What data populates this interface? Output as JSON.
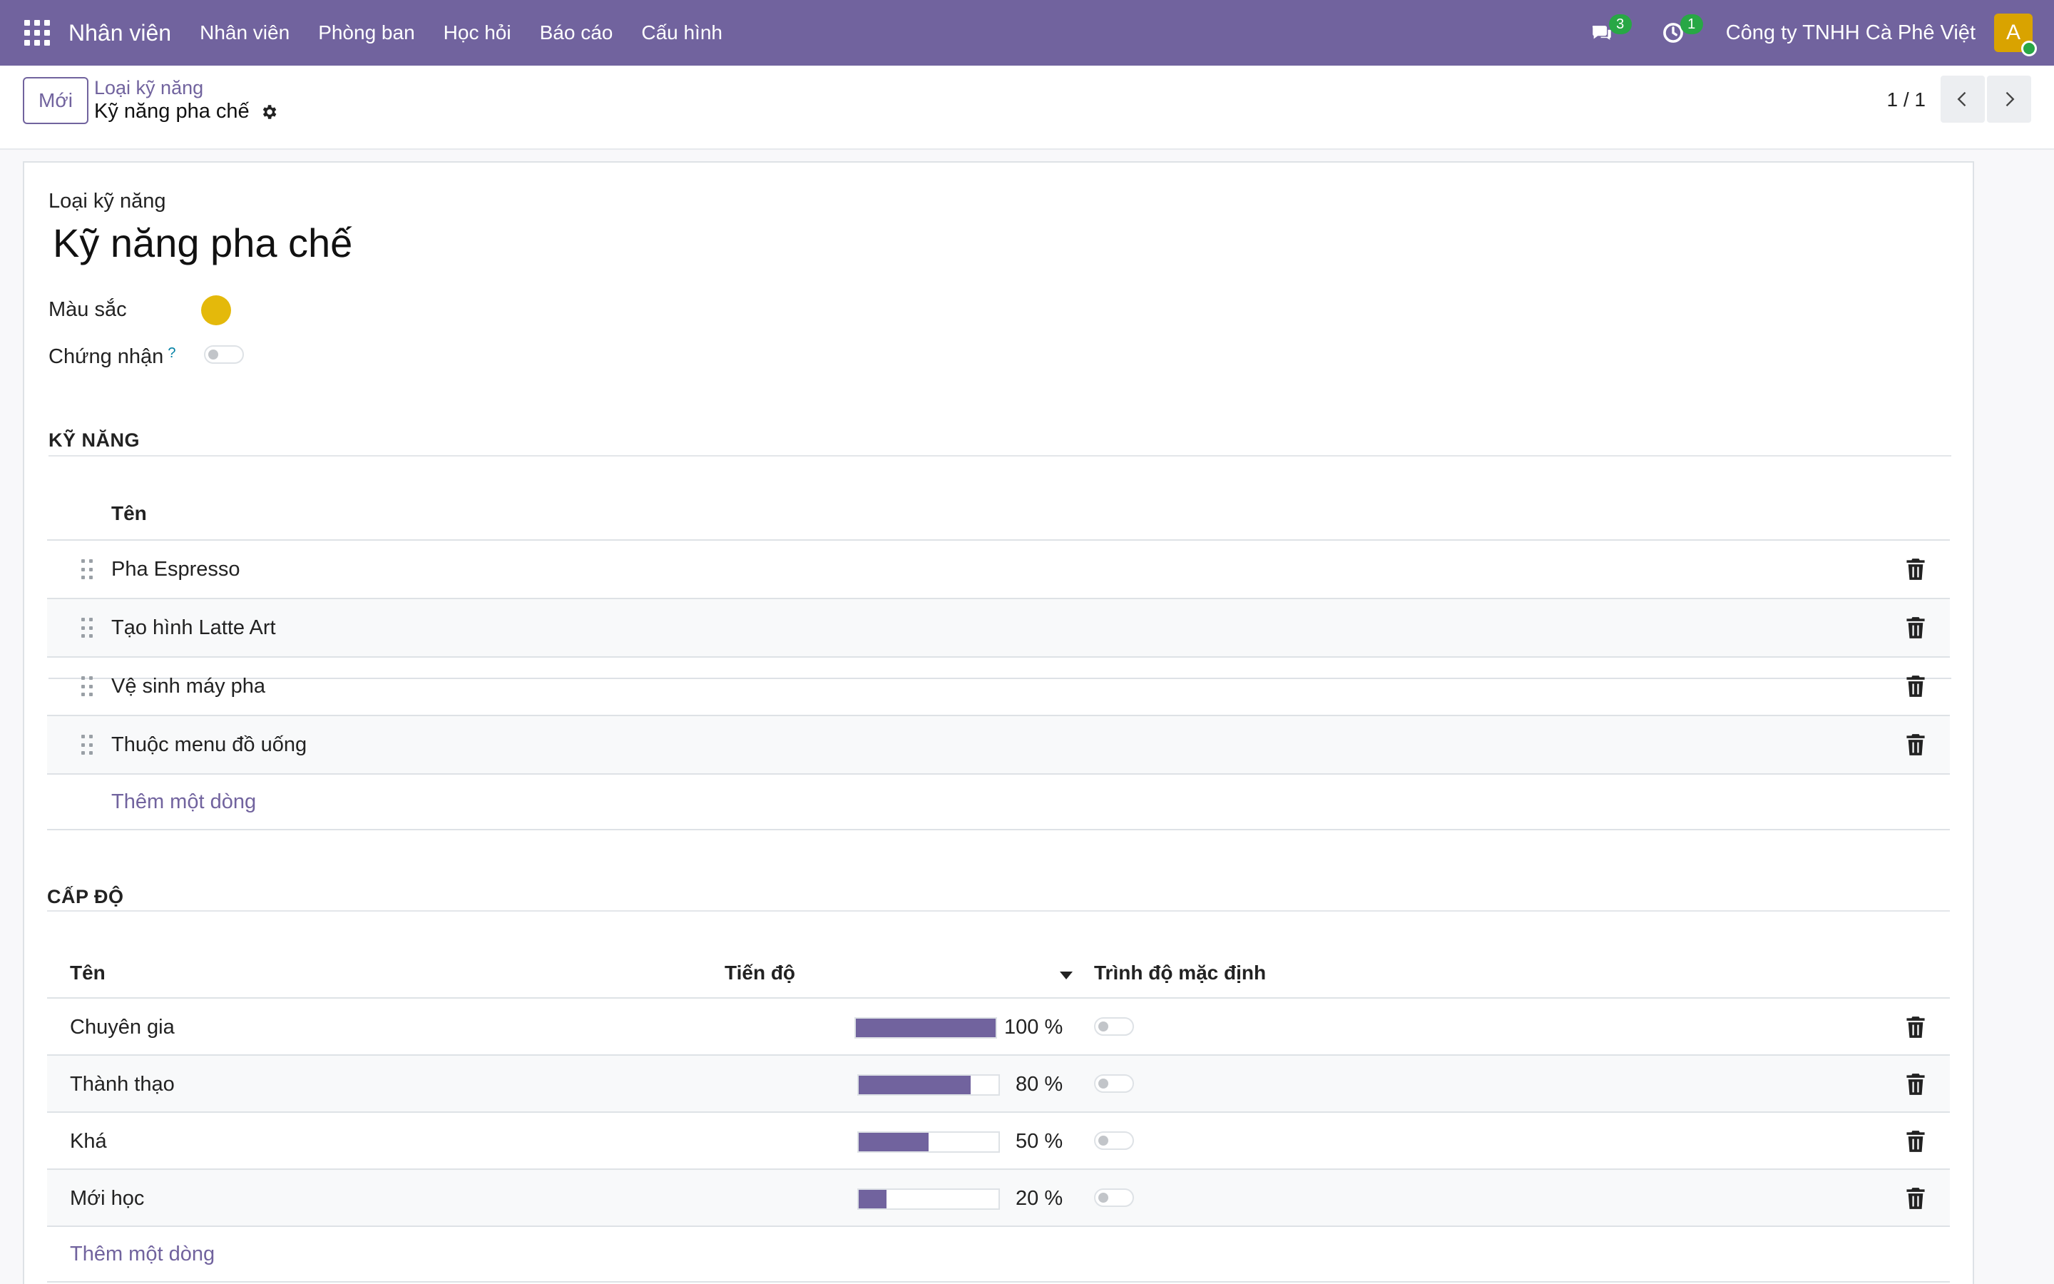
{
  "navbar": {
    "app_name": "Nhân viên",
    "menu": [
      "Nhân viên",
      "Phòng ban",
      "Học hỏi",
      "Báo cáo",
      "Cấu hình"
    ],
    "messages_count": "3",
    "activities_count": "1",
    "company": "Công ty TNHH Cà Phê Việt",
    "avatar_initial": "A"
  },
  "control": {
    "new_button": "Mới",
    "breadcrumb_parent": "Loại kỹ năng",
    "breadcrumb_current": "Kỹ năng pha chế",
    "pager": "1 / 1"
  },
  "form": {
    "type_label": "Loại kỹ năng",
    "name": "Kỹ năng pha chế",
    "color_label": "Màu sắc",
    "color_value": "#e4b90b",
    "certification_label": "Chứng nhận",
    "certification_help": "?",
    "certification_enabled": false
  },
  "skills": {
    "section_title": "KỸ NĂNG",
    "column_name": "Tên",
    "rows": [
      {
        "name": "Pha Espresso"
      },
      {
        "name": "Tạo hình Latte Art"
      },
      {
        "name": "Vệ sinh máy pha"
      },
      {
        "name": "Thuộc menu đồ uống"
      }
    ],
    "add_line": "Thêm một dòng"
  },
  "levels": {
    "section_title": "CẤP ĐỘ",
    "column_name": "Tên",
    "column_progress": "Tiến độ",
    "column_default": "Trình độ mặc định",
    "rows": [
      {
        "name": "Chuyên gia",
        "progress": 100,
        "progress_label": "100 %",
        "default": false
      },
      {
        "name": "Thành thạo",
        "progress": 80,
        "progress_label": "80 %",
        "default": false
      },
      {
        "name": "Khá",
        "progress": 50,
        "progress_label": "50 %",
        "default": false
      },
      {
        "name": "Mới học",
        "progress": 20,
        "progress_label": "20 %",
        "default": false
      }
    ],
    "add_line": "Thêm một dòng"
  },
  "colors": {
    "brand": "#71639e",
    "badge": "#28a745"
  }
}
